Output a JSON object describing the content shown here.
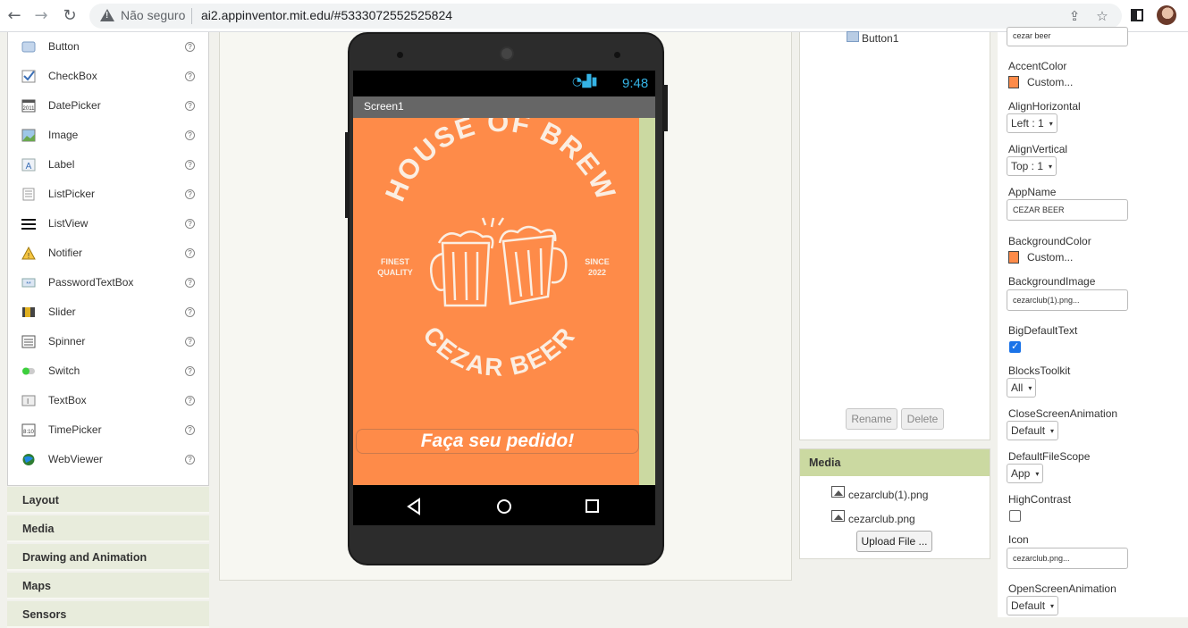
{
  "browser": {
    "not_secure": "Não seguro",
    "url": "ai2.appinventor.mit.edu/#5333072552525824"
  },
  "palette": {
    "items": [
      {
        "label": "Button",
        "icon": "button-icon"
      },
      {
        "label": "CheckBox",
        "icon": "checkbox-icon"
      },
      {
        "label": "DatePicker",
        "icon": "datepicker-icon"
      },
      {
        "label": "Image",
        "icon": "image-icon"
      },
      {
        "label": "Label",
        "icon": "label-icon"
      },
      {
        "label": "ListPicker",
        "icon": "listpicker-icon"
      },
      {
        "label": "ListView",
        "icon": "listview-icon"
      },
      {
        "label": "Notifier",
        "icon": "notifier-icon"
      },
      {
        "label": "PasswordTextBox",
        "icon": "password-icon"
      },
      {
        "label": "Slider",
        "icon": "slider-icon"
      },
      {
        "label": "Spinner",
        "icon": "spinner-icon"
      },
      {
        "label": "Switch",
        "icon": "switch-icon"
      },
      {
        "label": "TextBox",
        "icon": "textbox-icon"
      },
      {
        "label": "TimePicker",
        "icon": "timepicker-icon"
      },
      {
        "label": "WebViewer",
        "icon": "webviewer-icon"
      }
    ],
    "help": "?",
    "drawers": [
      "Layout",
      "Media",
      "Drawing and Animation",
      "Maps",
      "Sensors"
    ]
  },
  "viewer": {
    "status_time": "9:48",
    "screen_title": "Screen1",
    "logo_top": "HOUSE OF BREW",
    "logo_left": [
      "FINEST",
      "QUALITY"
    ],
    "logo_right": [
      "SINCE",
      "2022"
    ],
    "logo_bottom": "CEZAR BEER",
    "order_button": "Faça seu pedido!",
    "screen_color": "#fe8b49"
  },
  "components": {
    "button_node": "Button1",
    "rename": "Rename",
    "delete": "Delete"
  },
  "media": {
    "title": "Media",
    "files": [
      "cezarclub(1).png",
      "cezarclub.png"
    ],
    "upload": "Upload File ..."
  },
  "properties": {
    "top_text": "cezar beer",
    "accent_color": {
      "label": "AccentColor",
      "value": "Custom..."
    },
    "align_horizontal": {
      "label": "AlignHorizontal",
      "value": "Left : 1"
    },
    "align_vertical": {
      "label": "AlignVertical",
      "value": "Top : 1"
    },
    "app_name": {
      "label": "AppName",
      "value": "CEZAR BEER"
    },
    "background_color": {
      "label": "BackgroundColor",
      "value": "Custom..."
    },
    "background_image": {
      "label": "BackgroundImage",
      "value": "cezarclub(1).png..."
    },
    "big_default_text": {
      "label": "BigDefaultText",
      "checked": true
    },
    "blocks_toolkit": {
      "label": "BlocksToolkit",
      "value": "All"
    },
    "close_screen_animation": {
      "label": "CloseScreenAnimation",
      "value": "Default"
    },
    "default_file_scope": {
      "label": "DefaultFileScope",
      "value": "App"
    },
    "high_contrast": {
      "label": "HighContrast",
      "checked": false
    },
    "icon": {
      "label": "Icon",
      "value": "cezarclub.png..."
    },
    "open_screen_animation": {
      "label": "OpenScreenAnimation",
      "value": "Default"
    }
  }
}
